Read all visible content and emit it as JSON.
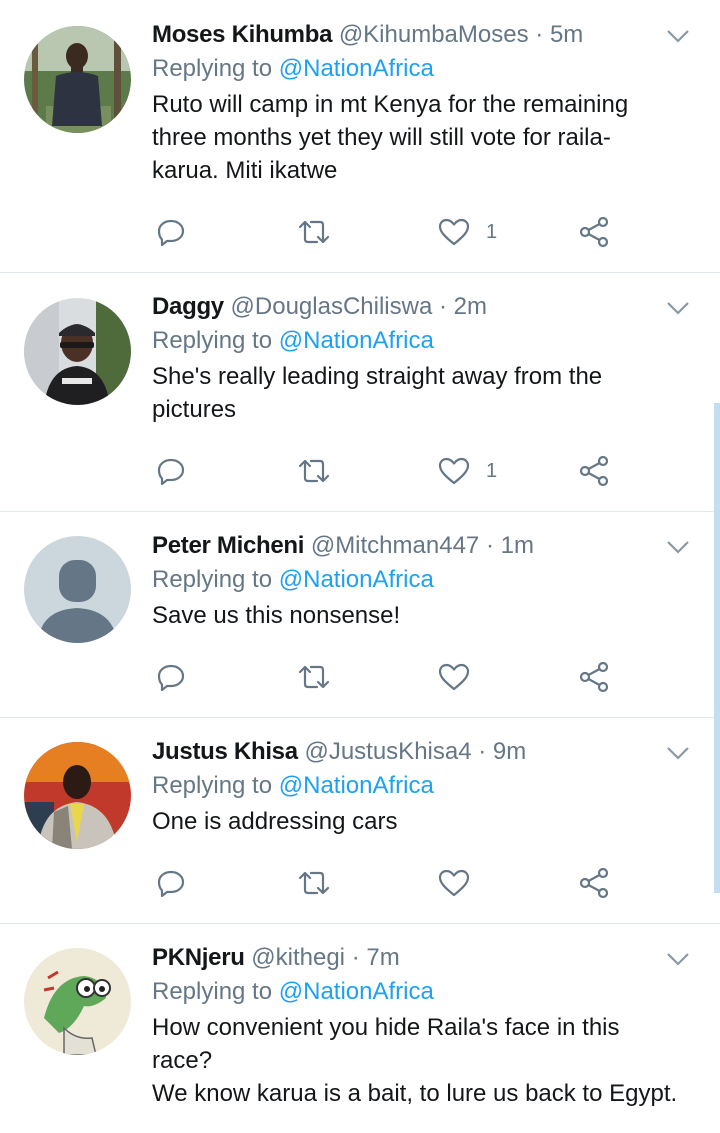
{
  "tweets": [
    {
      "name": "Moses Kihumba",
      "handle": "@KihumbaMoses",
      "time": "5m",
      "reply_label": "Replying to",
      "reply_to": "@NationAfrica",
      "text": "Ruto will camp in mt Kenya for the remaining three months yet they will still vote for raila-karua. Miti ikatwe",
      "like_count": "1"
    },
    {
      "name": "Daggy",
      "handle": "@DouglasChiliswa",
      "time": "2m",
      "reply_label": "Replying to",
      "reply_to": "@NationAfrica",
      "text": "She's really leading straight away from the pictures",
      "like_count": "1"
    },
    {
      "name": "Peter Micheni",
      "handle": "@Mitchman447",
      "time": "1m",
      "reply_label": "Replying to",
      "reply_to": "@NationAfrica",
      "text": "Save us this nonsense!",
      "like_count": ""
    },
    {
      "name": "Justus Khisa",
      "handle": "@JustusKhisa4",
      "time": "9m",
      "reply_label": "Replying to",
      "reply_to": "@NationAfrica",
      "text": "One is addressing cars",
      "like_count": ""
    },
    {
      "name": "PKNjeru",
      "handle": "@kithegi",
      "time": "7m",
      "reply_label": "Replying to",
      "reply_to": "@NationAfrica",
      "text_lines": [
        "How convenient you hide Raila's face in this race?",
        "We know karua is a bait, to lure us back to Egypt."
      ]
    }
  ],
  "separator": "·",
  "colors": {
    "accent": "#1da1f2",
    "secondary_text": "#657786",
    "divider": "#e1e8ed"
  }
}
